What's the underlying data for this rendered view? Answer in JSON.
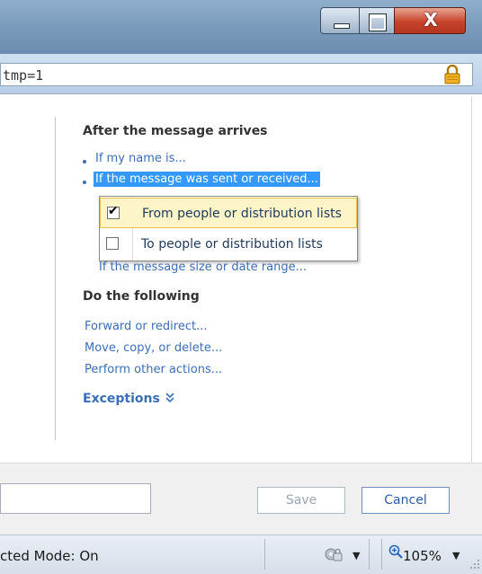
{
  "address": {
    "url_fragment": "tmp=1",
    "lock_icon": "padlock-icon"
  },
  "window": {
    "controls": [
      "minimize",
      "maximize",
      "close"
    ],
    "close_glyph": "X"
  },
  "rules": {
    "after_arrives": {
      "title": "After the message arrives",
      "items": [
        "If my name is...",
        "If the message was sent or received..."
      ],
      "selected_index": 1
    },
    "menu": {
      "items": [
        {
          "label": "From people or distribution lists",
          "checked": true,
          "highlighted": true
        },
        {
          "label": "To people or distribution lists",
          "checked": false,
          "highlighted": false
        }
      ]
    },
    "size_date_link": "If the message size or date range...",
    "do_following": {
      "title": "Do the following",
      "items": [
        "Forward or redirect...",
        "Move, copy, or delete...",
        "Perform other actions..."
      ]
    },
    "exceptions": {
      "label": "Exceptions",
      "icon": "double-chevron-down-icon"
    }
  },
  "footer": {
    "save_label": "Save",
    "cancel_label": "Cancel"
  },
  "status": {
    "protected_mode": "cted Mode: On",
    "zoom": "105%"
  },
  "colors": {
    "link": "#3b6eb8",
    "selection": "#3399ff",
    "menu_hover": "#fdf4c8"
  }
}
